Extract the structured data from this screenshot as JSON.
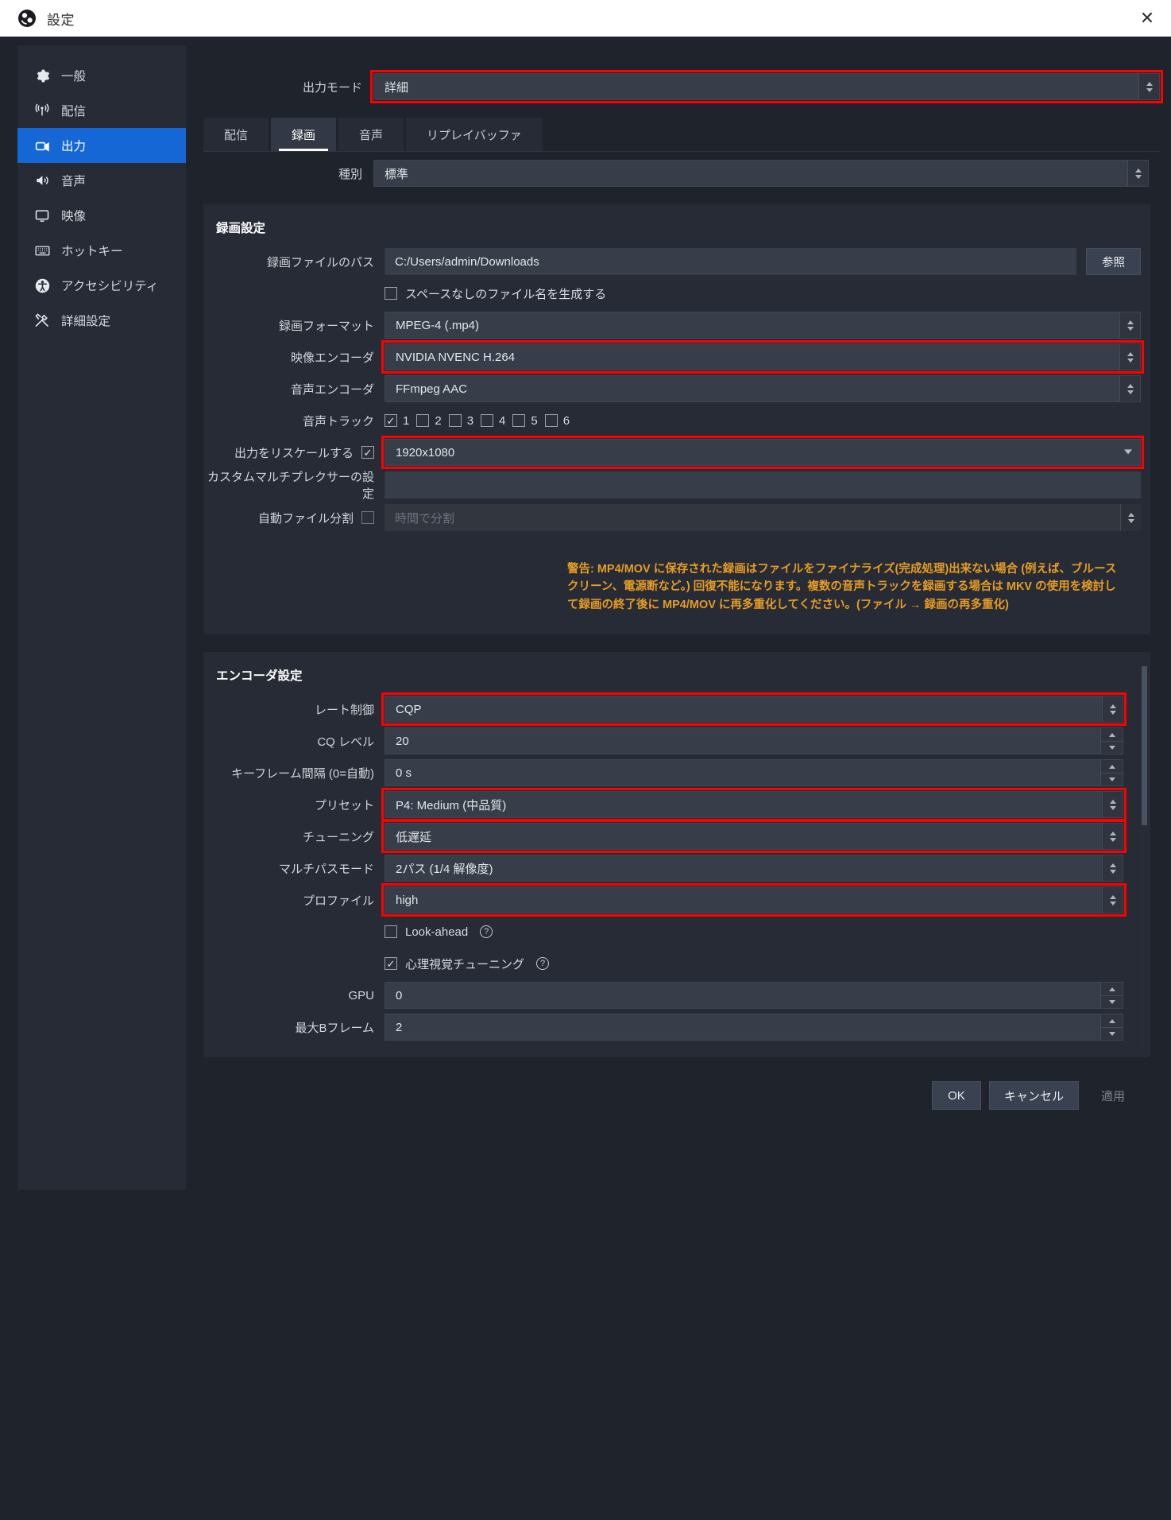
{
  "window": {
    "title": "設定",
    "close_label": "✕",
    "logo_icon": "obs-logo-icon"
  },
  "sidebar": {
    "items": [
      {
        "label": "一般",
        "icon": "gear-icon",
        "active": false
      },
      {
        "label": "配信",
        "icon": "broadcast-icon",
        "active": false
      },
      {
        "label": "出力",
        "icon": "output-camera-icon",
        "active": true
      },
      {
        "label": "音声",
        "icon": "speaker-icon",
        "active": false
      },
      {
        "label": "映像",
        "icon": "monitor-icon",
        "active": false
      },
      {
        "label": "ホットキー",
        "icon": "keyboard-icon",
        "active": false
      },
      {
        "label": "アクセシビリティ",
        "icon": "accessibility-icon",
        "active": false
      },
      {
        "label": "詳細設定",
        "icon": "tools-icon",
        "active": false
      }
    ]
  },
  "output_mode": {
    "label": "出力モード",
    "value": "詳細"
  },
  "tabs": [
    {
      "label": "配信",
      "active": false
    },
    {
      "label": "録画",
      "active": true
    },
    {
      "label": "音声",
      "active": false
    },
    {
      "label": "リプレイバッファ",
      "active": false
    }
  ],
  "kind": {
    "label": "種別",
    "value": "標準"
  },
  "recording": {
    "group_title": "録画設定",
    "path": {
      "label": "録画ファイルのパス",
      "value": "C:/Users/admin/Downloads",
      "browse": "参照"
    },
    "nospace": {
      "label": "スペースなしのファイル名を生成する",
      "checked": false
    },
    "format": {
      "label": "録画フォーマット",
      "value": "MPEG-4 (.mp4)"
    },
    "video_encoder": {
      "label": "映像エンコーダ",
      "value": "NVIDIA NVENC H.264"
    },
    "audio_encoder": {
      "label": "音声エンコーダ",
      "value": "FFmpeg AAC"
    },
    "audio_tracks": {
      "label": "音声トラック",
      "tracks": [
        {
          "num": "1",
          "checked": true
        },
        {
          "num": "2",
          "checked": false
        },
        {
          "num": "3",
          "checked": false
        },
        {
          "num": "4",
          "checked": false
        },
        {
          "num": "5",
          "checked": false
        },
        {
          "num": "6",
          "checked": false
        }
      ]
    },
    "rescale": {
      "label": "出力をリスケールする",
      "checked": true,
      "value": "1920x1080"
    },
    "muxer": {
      "label": "カスタムマルチプレクサーの設定",
      "value": ""
    },
    "autosplit": {
      "label": "自動ファイル分割",
      "checked": false,
      "placeholder": "時間で分割"
    },
    "warning": "警告: MP4/MOV に保存された録画はファイルをファイナライズ(完成処理)出来ない場合 (例えば、ブルースクリーン、電源断など。) 回復不能になります。複数の音声トラックを録画する場合は MKV の使用を検討して録画の終了後に MP4/MOV に再多重化してください。(ファイル → 録画の再多重化)"
  },
  "encoder": {
    "group_title": "エンコーダ設定",
    "rows": [
      {
        "label": "レート制御",
        "value": "CQP",
        "type": "combo",
        "highlight": true
      },
      {
        "label": "CQ レベル",
        "value": "20",
        "type": "spin",
        "highlight": false
      },
      {
        "label": "キーフレーム間隔 (0=自動)",
        "value": "0 s",
        "type": "spin",
        "highlight": false
      },
      {
        "label": "プリセット",
        "value": "P4: Medium (中品質)",
        "type": "combo",
        "highlight": true
      },
      {
        "label": "チューニング",
        "value": "低遅延",
        "type": "combo",
        "highlight": true
      },
      {
        "label": "マルチパスモード",
        "value": "2パス (1/4 解像度)",
        "type": "combo",
        "highlight": false
      },
      {
        "label": "プロファイル",
        "value": "high",
        "type": "combo",
        "highlight": true
      }
    ],
    "lookahead": {
      "label": "Look-ahead",
      "checked": false,
      "help": "?"
    },
    "psycho": {
      "label": "心理視覚チューニング",
      "checked": true,
      "help": "?"
    },
    "gpu": {
      "label": "GPU",
      "value": "0"
    },
    "maxb": {
      "label": "最大Bフレーム",
      "value": "2"
    }
  },
  "footer": {
    "ok": "OK",
    "cancel": "キャンセル",
    "apply": "適用"
  },
  "colors": {
    "accent": "#1667d6",
    "highlight": "#ff0000",
    "warning": "#e79c23"
  }
}
